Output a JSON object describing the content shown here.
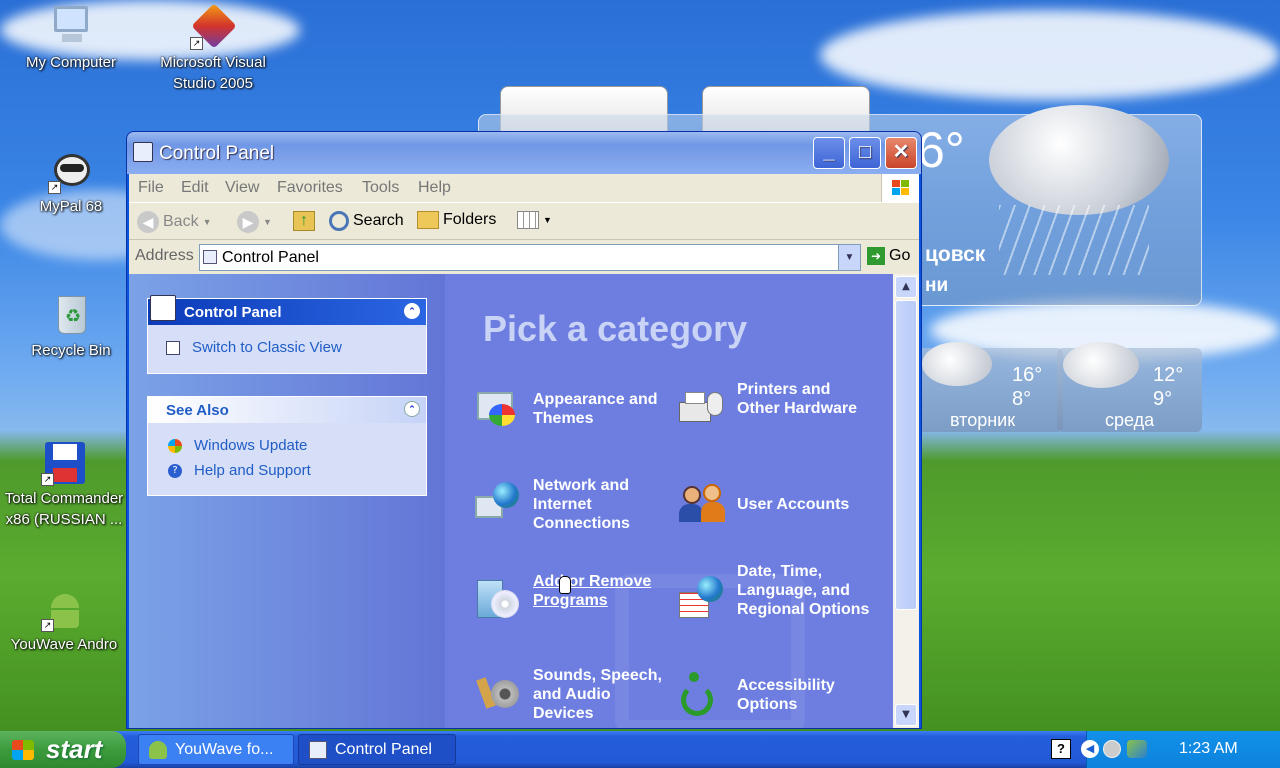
{
  "desktop": {
    "icons": [
      {
        "label": "My Computer"
      },
      {
        "label": "Microsoft Visual Studio 2005"
      },
      {
        "label": "MyPal 68"
      },
      {
        "label": "Recycle Bin"
      },
      {
        "label": "Total Commander x86 (RUSSIAN ..."
      },
      {
        "label": "YouWave Andro"
      }
    ]
  },
  "weather": {
    "temp": "6°",
    "city": "цовск",
    "sub": "ни",
    "days": [
      {
        "high": "16°",
        "low": "8°",
        "day": "вторник"
      },
      {
        "high": "12°",
        "low": "9°",
        "day": "среда"
      }
    ]
  },
  "window": {
    "title": "Control Panel",
    "menu": [
      "File",
      "Edit",
      "View",
      "Favorites",
      "Tools",
      "Help"
    ],
    "toolbar": {
      "back": "Back",
      "search": "Search",
      "folders": "Folders"
    },
    "address": {
      "label": "Address",
      "value": "Control Panel",
      "go": "Go"
    },
    "taskpane": {
      "cp_title": "Control Panel",
      "switch_view": "Switch to Classic View",
      "see_also_title": "See Also",
      "links": [
        "Windows Update",
        "Help and Support"
      ]
    },
    "main": {
      "heading": "Pick a category",
      "categories": [
        {
          "label": "Appearance and Themes",
          "icon": "appearance-icon"
        },
        {
          "label": "Printers and Other Hardware",
          "icon": "printer-icon"
        },
        {
          "label": "Network and Internet Connections",
          "icon": "network-icon"
        },
        {
          "label": "User Accounts",
          "icon": "users-icon"
        },
        {
          "label": "Add or Remove Programs",
          "icon": "add-remove-icon"
        },
        {
          "label": "Date, Time, Language, and Regional Options",
          "icon": "calendar-globe-icon"
        },
        {
          "label": "Sounds, Speech, and Audio Devices",
          "icon": "speaker-icon"
        },
        {
          "label": "Accessibility Options",
          "icon": "accessibility-icon"
        }
      ]
    }
  },
  "taskbar": {
    "start": "start",
    "items": [
      "YouWave fo...",
      "Control Panel"
    ],
    "clock": "1:23 AM"
  }
}
